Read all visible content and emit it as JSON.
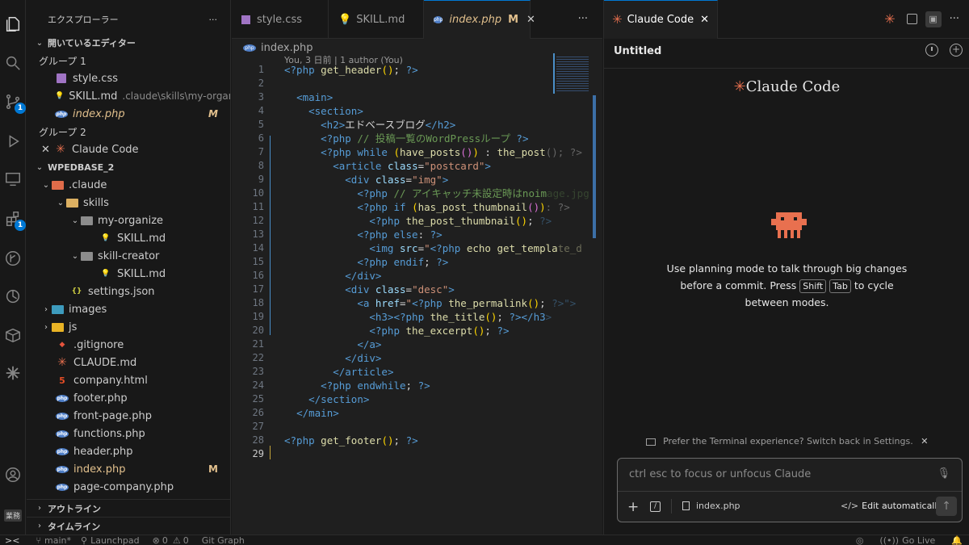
{
  "activity": {
    "source_badge": "1",
    "ext_badge": "1",
    "bottom_label": "業務"
  },
  "sidebar": {
    "title": "エクスプローラー",
    "open_editors_label": "開いているエディター",
    "group1_label": "グループ 1",
    "group2_label": "グループ 2",
    "open_editors": [
      {
        "name": "style.css",
        "desc": "",
        "mod": ""
      },
      {
        "name": "SKILL.md",
        "desc": ".claude\\skills\\my-organize",
        "mod": ""
      },
      {
        "name": "index.php",
        "desc": "",
        "mod": "M"
      }
    ],
    "group2_item": "Claude Code",
    "workspace_label": "WPEDBASE_2",
    "tree": [
      {
        "name": ".claude"
      },
      {
        "name": "skills"
      },
      {
        "name": "my-organize"
      },
      {
        "name": "SKILL.md"
      },
      {
        "name": "skill-creator"
      },
      {
        "name": "SKILL.md"
      },
      {
        "name": "settings.json"
      },
      {
        "name": "images"
      },
      {
        "name": "js"
      },
      {
        "name": ".gitignore"
      },
      {
        "name": "CLAUDE.md"
      },
      {
        "name": "company.html"
      },
      {
        "name": "footer.php"
      },
      {
        "name": "front-page.php"
      },
      {
        "name": "functions.php"
      },
      {
        "name": "header.php"
      },
      {
        "name": "index.php",
        "mod": "M"
      },
      {
        "name": "page-company.php"
      }
    ],
    "outline_label": "アウトライン",
    "timeline_label": "タイムライン"
  },
  "editor": {
    "tabs": [
      {
        "label": "style.css"
      },
      {
        "label": "SKILL.md"
      },
      {
        "label": "index.php",
        "mod": "M"
      }
    ],
    "breadcrumb": "index.php",
    "blame": "You, 3 日前 | 1 author (You)",
    "line_numbers": [
      "1",
      "2",
      "3",
      "4",
      "5",
      "6",
      "7",
      "8",
      "9",
      "10",
      "11",
      "12",
      "13",
      "14",
      "15",
      "16",
      "17",
      "18",
      "19",
      "20",
      "21",
      "22",
      "23",
      "24",
      "25",
      "26",
      "27",
      "28",
      "29"
    ]
  },
  "claude": {
    "tab_label": "Claude Code",
    "session_title": "Untitled",
    "logo_text": "Claude Code",
    "hint_line1": "Use planning mode to talk through big changes",
    "hint_line2_pre": "before a commit. Press",
    "hint_key1": "Shift",
    "hint_key2": "Tab",
    "hint_line2_post": "to cycle",
    "hint_line3": "between modes.",
    "terminal_prefix": "Prefer the Terminal experience?",
    "terminal_link": "Switch back in Settings.",
    "input_placeholder": "ctrl esc to focus or unfocus Claude",
    "context_file": "index.php",
    "edit_mode": "Edit automatically",
    "accent": "#e8704f"
  },
  "status": {
    "branch": "main*",
    "launchpad": "Launchpad",
    "errors": "0",
    "warnings": "0",
    "git_graph": "Git Graph",
    "go_live": "Go Live"
  }
}
